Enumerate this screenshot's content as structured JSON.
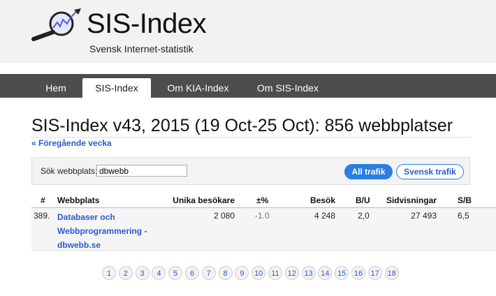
{
  "header": {
    "title": "SIS-Index",
    "subtitle": "Svensk Internet-statistik",
    "logo_icon": "magnifier-graph-icon"
  },
  "nav": {
    "items": [
      {
        "label": "Hem",
        "active": false
      },
      {
        "label": "SIS-Index",
        "active": true
      },
      {
        "label": "Om KIA-Index",
        "active": false
      },
      {
        "label": "Om SIS-Index",
        "active": false
      }
    ]
  },
  "main": {
    "title": "SIS-Index v43, 2015 (19 Oct-25 Oct): 856 webbplatser",
    "prev_link": "« Föregående vecka"
  },
  "search": {
    "label": "Sök webbplats:",
    "value": "dbwebb",
    "all_button": "All trafik",
    "swedish_button": "Svensk trafik"
  },
  "table": {
    "columns": [
      "#",
      "Webbplats",
      "Unika besökare",
      "±%",
      "Besök",
      "B/U",
      "Sidvisningar",
      "S/B"
    ],
    "rows": [
      {
        "rank": "389.",
        "site_line1": "Databaser och",
        "site_line2": "Webbprogrammering -",
        "site_line3": "dbwebb.se",
        "unique_visitors": "2 080",
        "change": "-1.0",
        "visits": "4 248",
        "bu": "2,0",
        "pageviews": "27 493",
        "sb": "6,5"
      }
    ]
  },
  "pager": {
    "pages": [
      "1",
      "2",
      "3",
      "4",
      "5",
      "6",
      "7",
      "8",
      "9",
      "10",
      "11",
      "12",
      "13",
      "14",
      "15",
      "16",
      "17",
      "18"
    ]
  },
  "colors": {
    "nav_bg": "#4d4d4d",
    "link": "#2a59d6",
    "button_blue": "#2a7fe0",
    "header_bg": "#f2f2f2"
  }
}
